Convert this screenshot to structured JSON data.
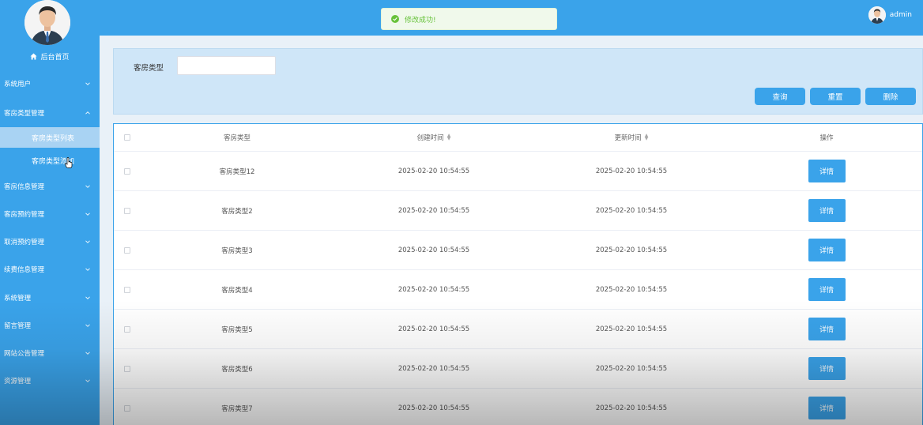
{
  "sidebar": {
    "home_label": "后台首页",
    "menu": [
      {
        "label": "系统用户",
        "expanded": false
      },
      {
        "label": "客房类型管理",
        "expanded": true
      },
      {
        "label": "客房信息管理",
        "expanded": false
      },
      {
        "label": "客房预约管理",
        "expanded": false
      },
      {
        "label": "取消预约管理",
        "expanded": false
      },
      {
        "label": "续费信息管理",
        "expanded": false
      },
      {
        "label": "系统管理",
        "expanded": false
      },
      {
        "label": "留言管理",
        "expanded": false
      },
      {
        "label": "网站公告管理",
        "expanded": false
      },
      {
        "label": "资源管理",
        "expanded": false
      }
    ],
    "submenu": [
      {
        "label": "客房类型列表",
        "active": true
      },
      {
        "label": "客房类型添加",
        "active": false
      }
    ]
  },
  "topbar": {
    "username": "admin"
  },
  "toast": {
    "message": "修改成功!",
    "type": "success"
  },
  "search": {
    "label": "客房类型",
    "value": "",
    "buttons": {
      "query": "查询",
      "reset": "重置",
      "delete": "删除"
    }
  },
  "table": {
    "headers": {
      "type": "客房类型",
      "created": "创建时间",
      "updated": "更新时间",
      "action": "操作"
    },
    "detail_label": "详情",
    "rows": [
      {
        "type": "客房类型12",
        "created": "2025-02-20 10:54:55",
        "updated": "2025-02-20 10:54:55"
      },
      {
        "type": "客房类型2",
        "created": "2025-02-20 10:54:55",
        "updated": "2025-02-20 10:54:55"
      },
      {
        "type": "客房类型3",
        "created": "2025-02-20 10:54:55",
        "updated": "2025-02-20 10:54:55"
      },
      {
        "type": "客房类型4",
        "created": "2025-02-20 10:54:55",
        "updated": "2025-02-20 10:54:55"
      },
      {
        "type": "客房类型5",
        "created": "2025-02-20 10:54:55",
        "updated": "2025-02-20 10:54:55"
      },
      {
        "type": "客房类型6",
        "created": "2025-02-20 10:54:55",
        "updated": "2025-02-20 10:54:55"
      },
      {
        "type": "客房类型7",
        "created": "2025-02-20 10:54:55",
        "updated": "2025-02-20 10:54:55"
      }
    ]
  },
  "colors": {
    "primary": "#3aa3ea",
    "success": "#67c23a"
  }
}
